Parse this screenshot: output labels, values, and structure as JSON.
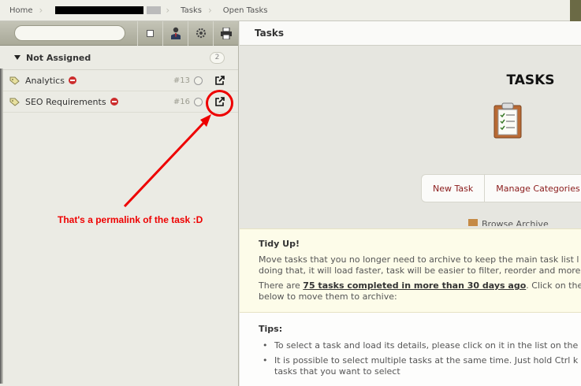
{
  "breadcrumb": {
    "items": [
      "Home",
      "Tasks",
      "Open Tasks"
    ]
  },
  "sidebar": {
    "group": {
      "label": "Not Assigned",
      "count": "2"
    },
    "tasks": [
      {
        "title": "Analytics",
        "number": "#13"
      },
      {
        "title": "SEO Requirements",
        "number": "#16"
      }
    ]
  },
  "annotation": {
    "text": "That's a permalink of the task :D",
    "color": "#ee0000"
  },
  "main": {
    "header_title": "Tasks",
    "big_title": "TASKS",
    "buttons": {
      "new_task": "New Task",
      "manage_categories": "Manage Categories"
    },
    "browse_archive": "Browse Archive",
    "tidy": {
      "title": "Tidy Up!",
      "line1": "Move tasks that you no longer need to archive to keep the main task list l",
      "line2": "doing that, it will load faster, task will be easier to filter, reorder and more",
      "line3_prefix": "There are ",
      "line3_link": "75 tasks completed in more than 30 days ago",
      "line3_suffix": ". Click on the",
      "line4": "below to move them to archive:"
    },
    "tips": {
      "title": "Tips:",
      "tip1": "To select a task and load its details, please click on it in the list on the",
      "tip2_line1": "It is possible to select multiple tasks at the same time. Just hold Ctrl k",
      "tip2_line2": "tasks that you want to select"
    }
  },
  "colors": {
    "accent_link": "#8a1a1a",
    "priority_red": "#cc2d2d"
  }
}
